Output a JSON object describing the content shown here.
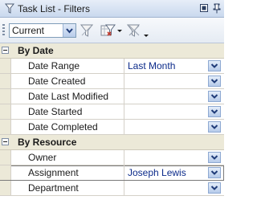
{
  "window": {
    "title": "Task List - Filters"
  },
  "toolbar": {
    "view_select": {
      "value": "Current"
    }
  },
  "sections": [
    {
      "label": "By Date",
      "rows": [
        {
          "label": "Date Range",
          "value": "Last Month"
        },
        {
          "label": "Date Created",
          "value": ""
        },
        {
          "label": "Date Last Modified",
          "value": ""
        },
        {
          "label": "Date Started",
          "value": ""
        },
        {
          "label": "Date Completed",
          "value": ""
        }
      ]
    },
    {
      "label": "By Resource",
      "rows": [
        {
          "label": "Owner",
          "value": ""
        },
        {
          "label": "Assignment",
          "value": "Joseph Lewis"
        },
        {
          "label": "Department",
          "value": ""
        }
      ]
    }
  ],
  "icons": {
    "title": "filter-icon",
    "close": "close-box-icon",
    "pin": "pin-icon",
    "dropdown": "chevron-down-icon"
  }
}
